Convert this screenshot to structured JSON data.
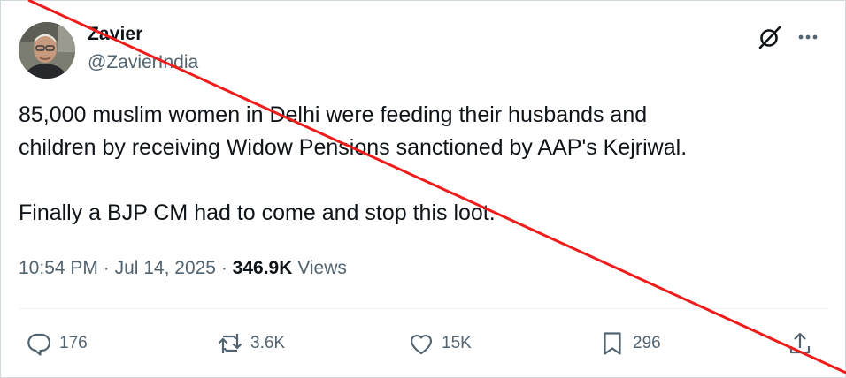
{
  "author": {
    "name": "Zavier",
    "handle": "@ZavierIndia"
  },
  "tweet": {
    "line1": "85,000 muslim women in Delhi were feeding their husbands and",
    "line2": "children by receiving Widow Pensions sanctioned by AAP's Kejriwal.",
    "line3": "Finally a BJP CM had to come and stop this loot."
  },
  "meta": {
    "time": "10:54 PM",
    "sep1": " · ",
    "date": "Jul 14, 2025",
    "sep2": " · ",
    "views_count": "346.9K",
    "views_label": " Views"
  },
  "actions": {
    "replies": "176",
    "reposts": "3.6K",
    "likes": "15K",
    "bookmarks": "296"
  },
  "icons": [
    "grok-icon",
    "more-icon",
    "reply-icon",
    "repost-icon",
    "like-icon",
    "bookmark-icon",
    "share-icon"
  ],
  "colors": {
    "text": "#0f1419",
    "secondary": "#536471",
    "strike": "#ef1c1c"
  }
}
